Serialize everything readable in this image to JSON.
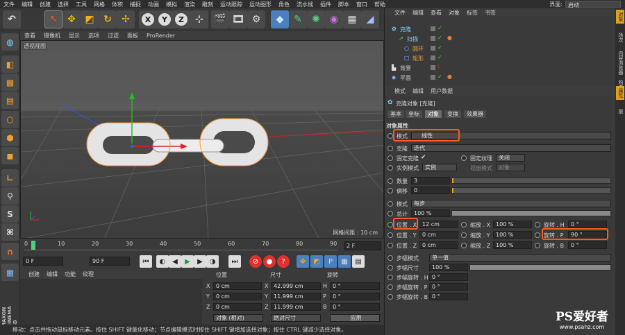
{
  "menubar": {
    "items": [
      "文件",
      "编辑",
      "创建",
      "选择",
      "工具",
      "网格",
      "体积",
      "捕捉",
      "动画",
      "模拟",
      "渲染",
      "雕刻",
      "运动跟踪",
      "运动图形",
      "角色",
      "流水线",
      "插件",
      "脚本",
      "窗口",
      "帮助"
    ],
    "layout_label": "界面:",
    "layout_value": "启动"
  },
  "viewport": {
    "menu": [
      "查看",
      "摄像机",
      "显示",
      "选项",
      "过滤",
      "面板",
      "ProRender"
    ],
    "label": "透视视图",
    "grid_text": "网格间距 : 10 cm"
  },
  "timeline": {
    "ticks": [
      "0",
      "10",
      "20",
      "30",
      "40",
      "50",
      "60",
      "70",
      "80",
      "90"
    ],
    "current_frame": "2 F"
  },
  "playbar": {
    "start": "0 F",
    "end": "90 F"
  },
  "material": {
    "menu": [
      "创建",
      "编辑",
      "功能",
      "纹理"
    ]
  },
  "coords": {
    "headers": [
      "位置",
      "尺寸",
      "旋转"
    ],
    "rows": [
      {
        "axis": "X",
        "pos": "0 cm",
        "size": "42.999 cm",
        "rot_label": "H",
        "rot": "0 °"
      },
      {
        "axis": "Y",
        "pos": "0 cm",
        "size": "11.999 cm",
        "rot_label": "P",
        "rot": "0 °"
      },
      {
        "axis": "Z",
        "pos": "0 cm",
        "size": "11.999 cm",
        "rot_label": "B",
        "rot": "0 °"
      }
    ],
    "mode1": "对象 (相对)",
    "mode2": "绝对尺寸",
    "apply": "应用"
  },
  "status": "移动：点击并拖动鼠标移动元素。按住 SHIFT 键量化移动；节点编辑模式时按住 SHIFT 键增加选择对象；按住 CTRL 键减少选择对象。",
  "object_manager": {
    "menu": [
      "文件",
      "编辑",
      "查看",
      "对象",
      "标签",
      "书签"
    ],
    "objects": [
      {
        "name": "克隆",
        "indent": 0,
        "color": "#7fd2ff"
      },
      {
        "name": "扫描",
        "indent": 1,
        "color": "#7fd2ff"
      },
      {
        "name": "圆环",
        "indent": 2,
        "color": "#e8a23c"
      },
      {
        "name": "矩形",
        "indent": 2,
        "color": "#e8a23c"
      },
      {
        "name": "背景",
        "indent": 0,
        "color": "#d0d0d0"
      },
      {
        "name": "平面",
        "indent": 0,
        "color": "#d0d0d0"
      }
    ]
  },
  "attributes": {
    "menu": [
      "模式",
      "编辑",
      "用户数据"
    ],
    "title": "克隆对象 [克隆]",
    "tabs": [
      "基本",
      "坐标",
      "对象",
      "变换",
      "效果器"
    ],
    "section": "对象属性",
    "mode_label": "模式",
    "mode_value": "线性",
    "clone_label": "克隆",
    "clone_value": "迭代",
    "fix_clone": "固定克隆",
    "fix_texture": "固定纹理",
    "fix_texture_value": "关闭",
    "instance_mode": "实例模式",
    "instance_value": "实例",
    "viewport_mode": "视窗模式",
    "viewport_value": "对象",
    "count_label": "数量",
    "count_value": "3",
    "offset_label": "偏移",
    "offset_value": "0",
    "mode2_label": "模式",
    "mode2_value": "每步",
    "total_label": "总计",
    "total_value": "100 %",
    "pos_x_label": "位置 . X",
    "pos_x": "12 cm",
    "scale_x_label": "缩放 . X",
    "scale_x": "100 %",
    "rot_h_label": "旋转 . H",
    "rot_h": "0 °",
    "pos_y_label": "位置 . Y",
    "pos_y": "0 cm",
    "scale_y_label": "缩放 . Y",
    "scale_y": "100 %",
    "rot_p_label": "旋转 . P",
    "rot_p": "90 °",
    "pos_z_label": "位置 . Z",
    "pos_z": "0 cm",
    "scale_z_label": "缩放 . Z",
    "scale_z": "100 %",
    "rot_b_label": "旋转 . B",
    "rot_b": "0 °",
    "step_mode_label": "步幅模式",
    "step_mode_value": "单一值",
    "step_size_label": "步幅尺寸",
    "step_size_value": "100 %",
    "step_rot_h_label": "步幅旋转 . H",
    "step_rot_h": "0 °",
    "step_rot_p_label": "步幅旋转 . P",
    "step_rot_p": "0 °",
    "step_rot_b_label": "步幅旋转 . B",
    "step_rot_b": "0 °"
  },
  "right_tabs": [
    "对象",
    "场次",
    "内容浏览器",
    "构造",
    "属性",
    "层"
  ],
  "watermark": {
    "brand": "PS爱好者",
    "url": "www.psahz.com"
  },
  "maxon": "MAXON CINEMA 4D"
}
